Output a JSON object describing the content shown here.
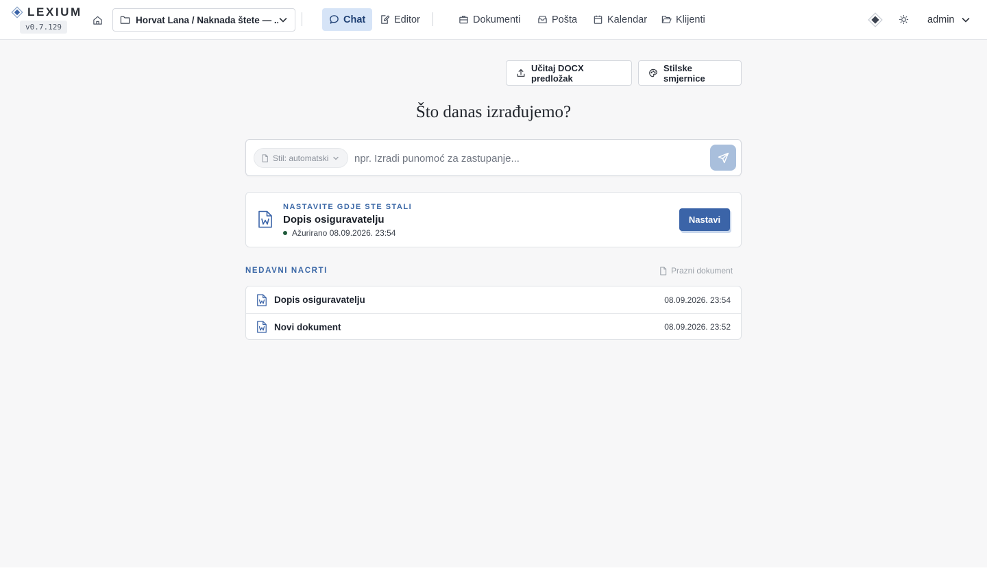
{
  "brand": {
    "name": "LEXIUM",
    "version": "v0.7.129"
  },
  "header": {
    "case_selector": "Horvat Lana / Naknada štete — ...",
    "nav": [
      {
        "label": "Chat",
        "icon": "chat-icon",
        "active": true
      },
      {
        "label": "Editor",
        "icon": "edit-icon",
        "active": false
      },
      {
        "label": "Dokumenti",
        "icon": "briefcase-icon",
        "active": false
      },
      {
        "label": "Pošta",
        "icon": "mail-icon",
        "active": false
      },
      {
        "label": "Kalendar",
        "icon": "calendar-icon",
        "active": false
      },
      {
        "label": "Klijenti",
        "icon": "folder-open-icon",
        "active": false
      }
    ],
    "user": "admin"
  },
  "actions": {
    "upload_template": "Učitaj DOCX predložak",
    "style_guidelines": "Stilske smjernice"
  },
  "main": {
    "heading": "Što danas izrađujemo?",
    "style_pill": "Stil: automatski",
    "prompt_placeholder": "npr. Izradi punomoć za zastupanje..."
  },
  "resume": {
    "eyebrow": "NASTAVITE GDJE STE STALI",
    "title": "Dopis osiguravatelju",
    "updated": "Ažurirano 08.09.2026. 23:54",
    "button": "Nastavi"
  },
  "drafts": {
    "title": "NEDAVNI NACRTI",
    "blank_doc": "Prazni dokument",
    "items": [
      {
        "name": "Dopis osiguravatelju",
        "date": "08.09.2026. 23:54"
      },
      {
        "name": "Novi dokument",
        "date": "08.09.2026. 23:52"
      }
    ]
  },
  "colors": {
    "accent": "#3b64a8",
    "active_tab_bg": "#d6e4f7",
    "eyebrow": "#3a67a6",
    "status_dot": "#1f5a3a"
  }
}
